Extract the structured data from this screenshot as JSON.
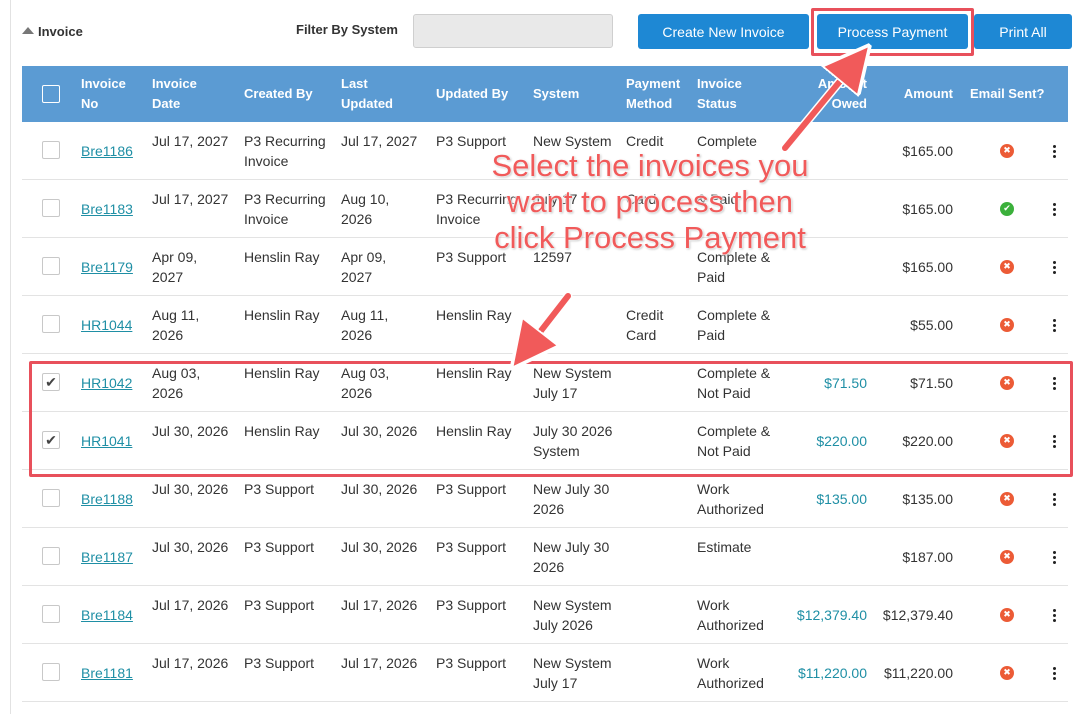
{
  "section": {
    "title": "Invoice"
  },
  "filter": {
    "label": "Filter By System",
    "value": "",
    "placeholder": ""
  },
  "buttons": {
    "create": "Create New Invoice",
    "process": "Process Payment",
    "print": "Print All"
  },
  "columns": {
    "invoice_no": "Invoice No",
    "invoice_date": "Invoice Date",
    "created_by": "Created By",
    "last_updated": "Last Updated",
    "updated_by": "Updated By",
    "system": "System",
    "payment_method": "Payment Method",
    "invoice_status": "Invoice Status",
    "amount_owed": "Amount Owed",
    "amount": "Amount",
    "email_sent": "Email Sent?"
  },
  "rows": [
    {
      "checked": false,
      "invoice_no": "Bre1186",
      "invoice_date": "Jul 17, 2027",
      "created_by": "P3 Recurring Invoice",
      "last_updated": "Jul 17, 2027",
      "updated_by": "P3 Support",
      "system": "New System",
      "payment_method": "Credit",
      "invoice_status": "Complete",
      "amount_owed": "",
      "amount": "$165.00",
      "email_sent": false
    },
    {
      "checked": false,
      "invoice_no": "Bre1183",
      "invoice_date": "Jul 17, 2027",
      "created_by": "P3 Recurring Invoice",
      "last_updated": "Aug 10, 2026",
      "updated_by": "P3 Recurring Invoice",
      "system": "July 17",
      "payment_method": "Card",
      "invoice_status": "& Paid",
      "amount_owed": "",
      "amount": "$165.00",
      "email_sent": true
    },
    {
      "checked": false,
      "invoice_no": "Bre1179",
      "invoice_date": "Apr 09, 2027",
      "created_by": "Henslin Ray",
      "last_updated": "Apr 09, 2027",
      "updated_by": "P3 Support",
      "system": "12597",
      "payment_method": "",
      "invoice_status": "Complete & Paid",
      "amount_owed": "",
      "amount": "$165.00",
      "email_sent": false
    },
    {
      "checked": false,
      "invoice_no": "HR1044",
      "invoice_date": "Aug 11, 2026",
      "created_by": "Henslin Ray",
      "last_updated": "Aug 11, 2026",
      "updated_by": "Henslin Ray",
      "system": "",
      "payment_method": "Credit Card",
      "invoice_status": "Complete & Paid",
      "amount_owed": "",
      "amount": "$55.00",
      "email_sent": false
    },
    {
      "checked": true,
      "invoice_no": "HR1042",
      "invoice_date": "Aug 03, 2026",
      "created_by": "Henslin Ray",
      "last_updated": "Aug 03, 2026",
      "updated_by": "Henslin Ray",
      "system": "New System July 17",
      "payment_method": "",
      "invoice_status": "Complete & Not Paid",
      "amount_owed": "$71.50",
      "amount": "$71.50",
      "email_sent": false
    },
    {
      "checked": true,
      "invoice_no": "HR1041",
      "invoice_date": "Jul 30, 2026",
      "created_by": "Henslin Ray",
      "last_updated": "Jul 30, 2026",
      "updated_by": "Henslin Ray",
      "system": "July 30 2026 System",
      "payment_method": "",
      "invoice_status": "Complete & Not Paid",
      "amount_owed": "$220.00",
      "amount": "$220.00",
      "email_sent": false
    },
    {
      "checked": false,
      "invoice_no": "Bre1188",
      "invoice_date": "Jul 30, 2026",
      "created_by": "P3 Support",
      "last_updated": "Jul 30, 2026",
      "updated_by": "P3 Support",
      "system": "New July 30 2026",
      "payment_method": "",
      "invoice_status": "Work Authorized",
      "amount_owed": "$135.00",
      "amount": "$135.00",
      "email_sent": false
    },
    {
      "checked": false,
      "invoice_no": "Bre1187",
      "invoice_date": "Jul 30, 2026",
      "created_by": "P3 Support",
      "last_updated": "Jul 30, 2026",
      "updated_by": "P3 Support",
      "system": "New July 30 2026",
      "payment_method": "",
      "invoice_status": "Estimate",
      "amount_owed": "",
      "amount": "$187.00",
      "email_sent": false
    },
    {
      "checked": false,
      "invoice_no": "Bre1184",
      "invoice_date": "Jul 17, 2026",
      "created_by": "P3 Support",
      "last_updated": "Jul 17, 2026",
      "updated_by": "P3 Support",
      "system": "New System July 2026",
      "payment_method": "",
      "invoice_status": "Work Authorized",
      "amount_owed": "$12,379.40",
      "amount": "$12,379.40",
      "email_sent": false
    },
    {
      "checked": false,
      "invoice_no": "Bre1181",
      "invoice_date": "Jul 17, 2026",
      "created_by": "P3 Support",
      "last_updated": "Jul 17, 2026",
      "updated_by": "P3 Support",
      "system": "New System July 17",
      "payment_method": "",
      "invoice_status": "Work Authorized",
      "amount_owed": "$11,220.00",
      "amount": "$11,220.00",
      "email_sent": false
    }
  ],
  "annotation": {
    "text": "Select the invoices you want to process then click Process Payment"
  },
  "colors": {
    "header_bg": "#5b9bd3",
    "button_bg": "#1e88d4",
    "link": "#1f8fa5",
    "highlight": "#e8505b",
    "email_no": "#ec5b36",
    "email_yes": "#3bb03b"
  },
  "icons": {
    "email_not_sent": "x-circle-icon",
    "email_sent": "check-circle-icon",
    "row_menu": "kebab-menu-icon",
    "collapse": "caret-up-icon"
  }
}
